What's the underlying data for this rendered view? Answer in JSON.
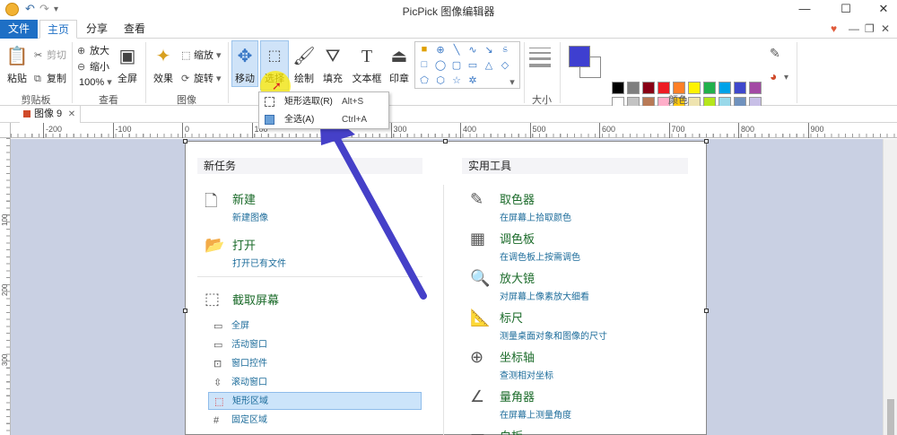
{
  "window": {
    "title": "PicPick 图像编辑器",
    "minimize": "—",
    "maximize": "☐",
    "close": "✕"
  },
  "tabs": {
    "file": "文件",
    "home": "主页",
    "share": "分享",
    "view": "查看"
  },
  "ribbon": {
    "clipboard": {
      "paste": "粘贴",
      "cut": "剪切",
      "copy": "复制",
      "label": "剪贴板"
    },
    "view": {
      "zoom_in": "放大",
      "zoom_out": "缩小",
      "zoom_level": "100%",
      "fullscreen": "全屏",
      "label": "查看"
    },
    "image": {
      "effects": "效果",
      "resize": "缩放",
      "rotate": "旋转",
      "label": "图像"
    },
    "tools": {
      "move": "移动",
      "select": "选择",
      "draw": "绘制",
      "fill": "填充",
      "textbox": "文本框",
      "stamp": "印章"
    },
    "size_label": "大小",
    "color_label": "颜色",
    "primary_color": "#3e3fd0",
    "swatches": [
      "#000000",
      "#7f7f7f",
      "#880015",
      "#ed1c24",
      "#ff7f27",
      "#fff200",
      "#22b14c",
      "#00a2e8",
      "#3f48cc",
      "#a349a4",
      "#ffffff",
      "#c3c3c3",
      "#b97a57",
      "#ffaec9",
      "#ffc90e",
      "#efe4b0",
      "#b5e61d",
      "#99d9ea",
      "#7092be",
      "#c8bfe7",
      "#ffffff",
      "#ffffff",
      "#ffffff",
      "#ffffff",
      "#ffffff",
      "#ffffff",
      "#ffffff",
      "#ffffff",
      "#ffffff",
      "#ffffff"
    ]
  },
  "select_menu": {
    "rect": {
      "label": "矩形选取(R)",
      "shortcut": "Alt+S"
    },
    "all": {
      "label": "全选(A)",
      "shortcut": "Ctrl+A"
    }
  },
  "document": {
    "tab": "图像 9"
  },
  "ruler": {
    "h": [
      "-200",
      "-100",
      "0",
      "100",
      "200",
      "300",
      "400",
      "500",
      "600",
      "700",
      "800",
      "900"
    ],
    "v": [
      "100",
      "200",
      "300"
    ]
  },
  "new_task": {
    "header": "新任务",
    "new": {
      "title": "新建",
      "sub": "新建图像"
    },
    "open": {
      "title": "打开",
      "sub": "打开已有文件"
    },
    "capture": {
      "title": "截取屏幕"
    },
    "capture_items": [
      "全屏",
      "活动窗口",
      "窗口控件",
      "滚动窗口",
      "矩形区域",
      "固定区域"
    ]
  },
  "utilities": {
    "header": "实用工具",
    "items": [
      {
        "title": "取色器",
        "sub": "在屏幕上拾取颜色"
      },
      {
        "title": "调色板",
        "sub": "在调色板上按需调色"
      },
      {
        "title": "放大镜",
        "sub": "对屏幕上像素放大细看"
      },
      {
        "title": "标尺",
        "sub": "测量桌面对象和图像的尺寸"
      },
      {
        "title": "坐标轴",
        "sub": "查测相对坐标"
      },
      {
        "title": "量角器",
        "sub": "在屏幕上测量角度"
      },
      {
        "title": "白板",
        "sub": ""
      }
    ]
  }
}
